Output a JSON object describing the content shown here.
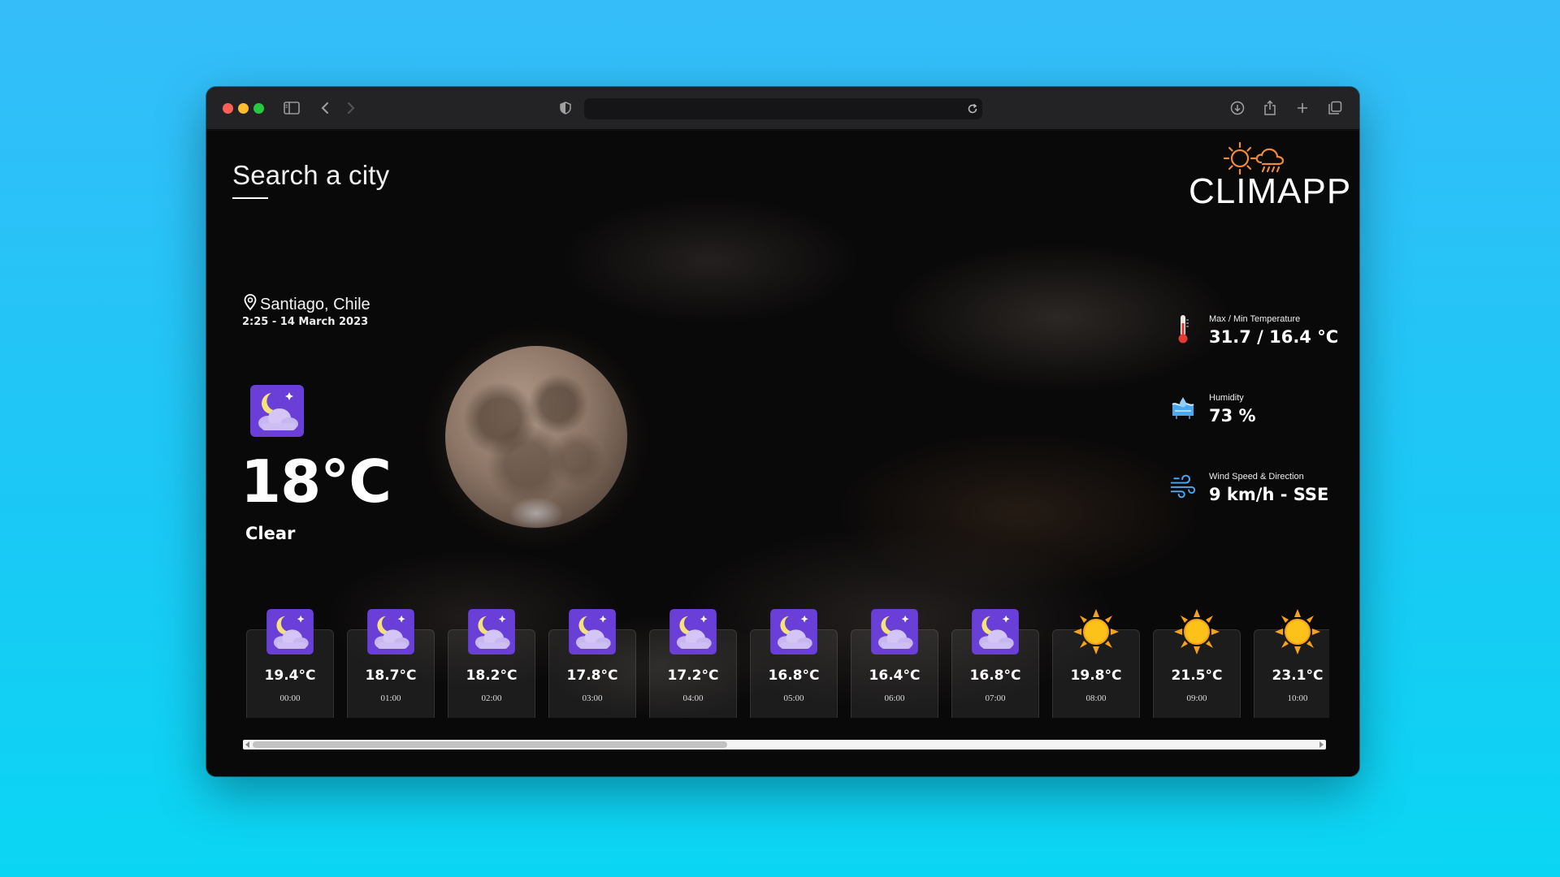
{
  "app": {
    "search_label": "Search a city",
    "logo_text": "CLIMAPP"
  },
  "current": {
    "location": "Santiago, Chile",
    "datetime": "2:25 - 14 March 2023",
    "temperature": "18°C",
    "condition": "Clear",
    "icon": "night-cloud-icon"
  },
  "stats": [
    {
      "label": "Max / Min Temperature",
      "value": "31.7 / 16.4 °C",
      "icon": "thermometer-icon"
    },
    {
      "label": "Humidity",
      "value": "73 %",
      "icon": "humidity-icon"
    },
    {
      "label": "Wind Speed & Direction",
      "value": "9 km/h - SSE",
      "icon": "wind-icon"
    }
  ],
  "forecast": [
    {
      "temp": "19.4°C",
      "hour": "00:00",
      "icon": "night-cloud-icon"
    },
    {
      "temp": "18.7°C",
      "hour": "01:00",
      "icon": "night-cloud-icon"
    },
    {
      "temp": "18.2°C",
      "hour": "02:00",
      "icon": "night-cloud-icon"
    },
    {
      "temp": "17.8°C",
      "hour": "03:00",
      "icon": "night-cloud-icon"
    },
    {
      "temp": "17.2°C",
      "hour": "04:00",
      "icon": "night-cloud-icon"
    },
    {
      "temp": "16.8°C",
      "hour": "05:00",
      "icon": "night-cloud-icon"
    },
    {
      "temp": "16.4°C",
      "hour": "06:00",
      "icon": "night-cloud-icon"
    },
    {
      "temp": "16.8°C",
      "hour": "07:00",
      "icon": "night-cloud-icon"
    },
    {
      "temp": "19.8°C",
      "hour": "08:00",
      "icon": "sun-icon"
    },
    {
      "temp": "21.5°C",
      "hour": "09:00",
      "icon": "sun-icon"
    },
    {
      "temp": "23.1°C",
      "hour": "10:00",
      "icon": "sun-icon"
    }
  ],
  "colors": {
    "night_icon_bg": "#6a3fd8",
    "sun": "#fdb813",
    "logo_orange": "#f08a3c",
    "background": "#1ac9f5"
  }
}
